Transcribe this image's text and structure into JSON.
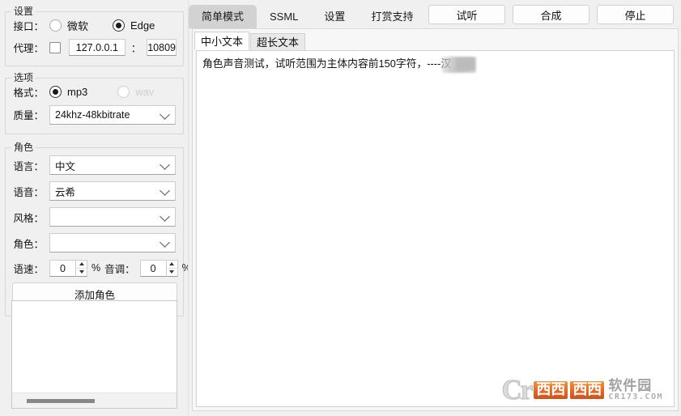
{
  "left_panel": {
    "settings_group": {
      "title": "设置",
      "interface_label": "接口：",
      "interface_options": [
        {
          "label": "微软",
          "checked": false
        },
        {
          "label": "Edge",
          "checked": true
        }
      ],
      "proxy_label": "代理：",
      "proxy_checked": false,
      "proxy_host": "127.0.0.1",
      "proxy_separator": "：",
      "proxy_port": "10809"
    },
    "options_group": {
      "title": "选项",
      "format_label": "格式：",
      "format_options": [
        {
          "label": "mp3",
          "checked": true,
          "disabled": false
        },
        {
          "label": "wav",
          "checked": false,
          "disabled": true
        }
      ],
      "quality_label": "质量：",
      "quality_value": "24khz-48kbitrate"
    },
    "role_group": {
      "title": "角色",
      "language_label": "语言：",
      "language_value": "中文",
      "voice_label": "语音：",
      "voice_value": "云希",
      "style_label": "风格：",
      "style_value": "",
      "role_label": "角色：",
      "role_value": "",
      "rate_label": "语速：",
      "rate_value": "0",
      "rate_unit": "%",
      "pitch_label": "音调：",
      "pitch_value": "0",
      "pitch_unit": "%",
      "add_role_button": "添加角色"
    },
    "role_list_items": []
  },
  "right_panel": {
    "main_tabs": [
      {
        "label": "简单模式",
        "active": true
      },
      {
        "label": "SSML",
        "active": false
      },
      {
        "label": "设置",
        "active": false
      },
      {
        "label": "打赏支持",
        "active": false
      }
    ],
    "action_buttons": [
      {
        "label": "试听"
      },
      {
        "label": "合成"
      },
      {
        "label": "停止"
      }
    ],
    "sub_tabs": [
      {
        "label": "中小文本",
        "active": true
      },
      {
        "label": "超长文本",
        "active": false
      }
    ],
    "editor_text": "角色声音测试，试听范围为主体内容前150字符，----汉"
  },
  "watermark": {
    "letter": "Cr",
    "box1": "西西",
    "box2": "西西",
    "soft": "软件园",
    "url": "CR173.COM"
  },
  "colors": {
    "window_bg": "#f0f0f0",
    "panel_bg": "#f7f7f7",
    "editor_bg": "#ffffff",
    "active_tab": "#d2d2d2",
    "border": "#d2d2d2",
    "text": "#1a1a1a",
    "disabled_text": "#cfcfcf",
    "watermark_orange": "#e35b12"
  }
}
